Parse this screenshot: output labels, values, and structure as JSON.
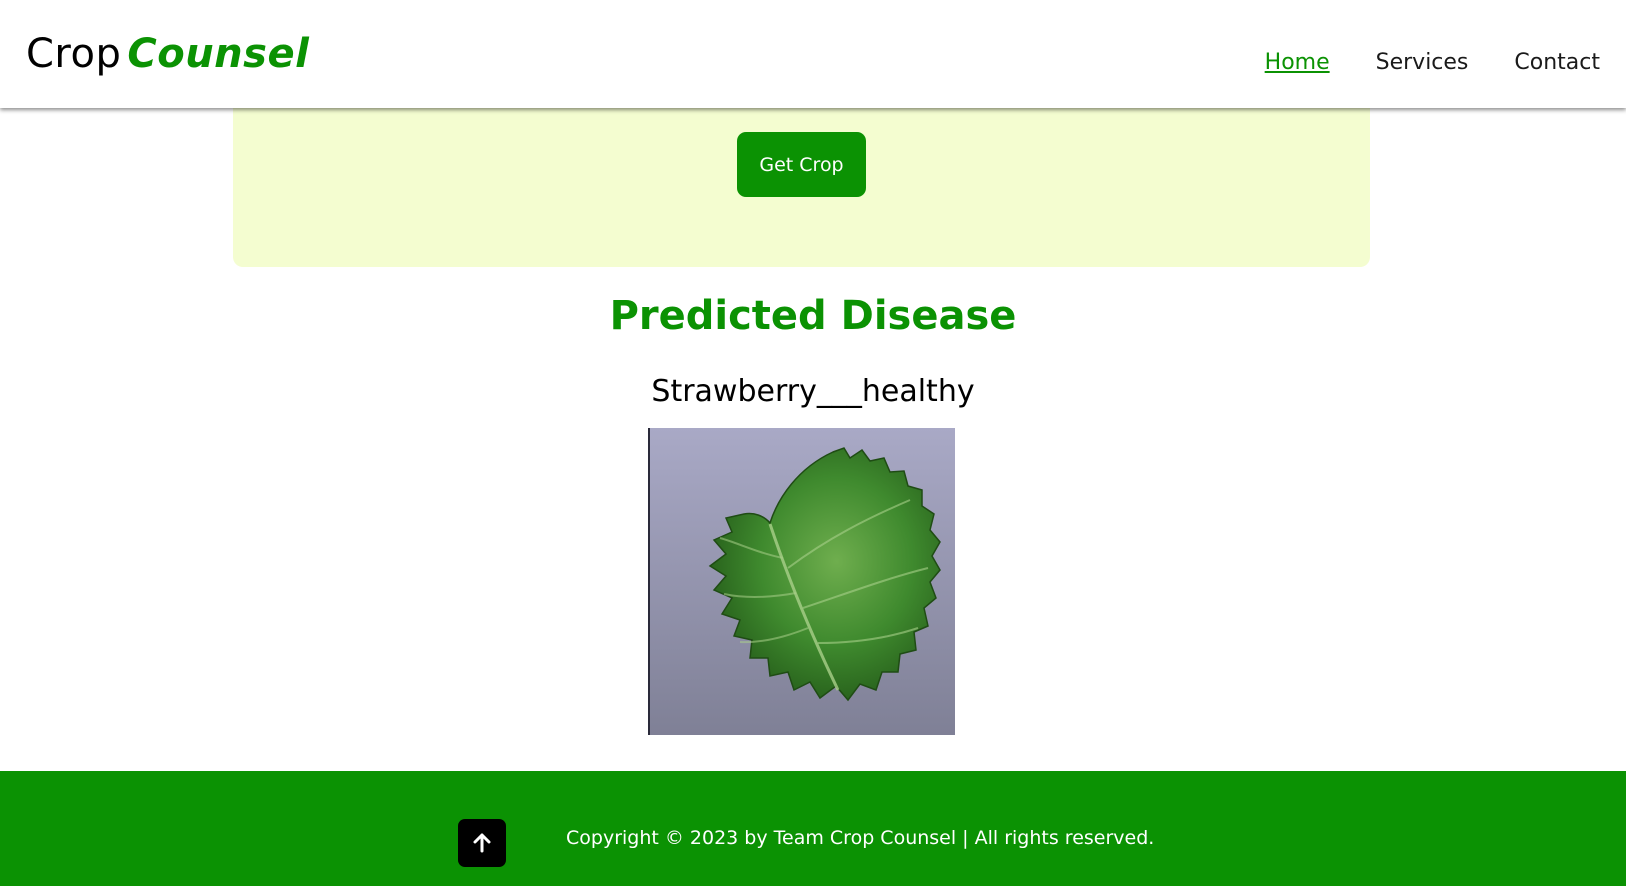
{
  "brand": {
    "name_plain": "Crop",
    "name_accent": "Counsel"
  },
  "nav": {
    "items": [
      {
        "label": "Home",
        "active": true
      },
      {
        "label": "Services",
        "active": false
      },
      {
        "label": "Contact",
        "active": false
      }
    ]
  },
  "form": {
    "submit_label": "Get Crop"
  },
  "result": {
    "heading": "Predicted Disease",
    "value": "Strawberry___healthy",
    "image_icon": "strawberry-leaf-photo"
  },
  "footer": {
    "copyright": "Copyright © 2023 by Team Crop Counsel | All rights reserved.",
    "scroll_top_icon": "arrow-up-icon"
  },
  "colors": {
    "brand_green": "#0b9203",
    "panel_bg": "#f4fdd0",
    "footer_bg": "#0b9203"
  }
}
